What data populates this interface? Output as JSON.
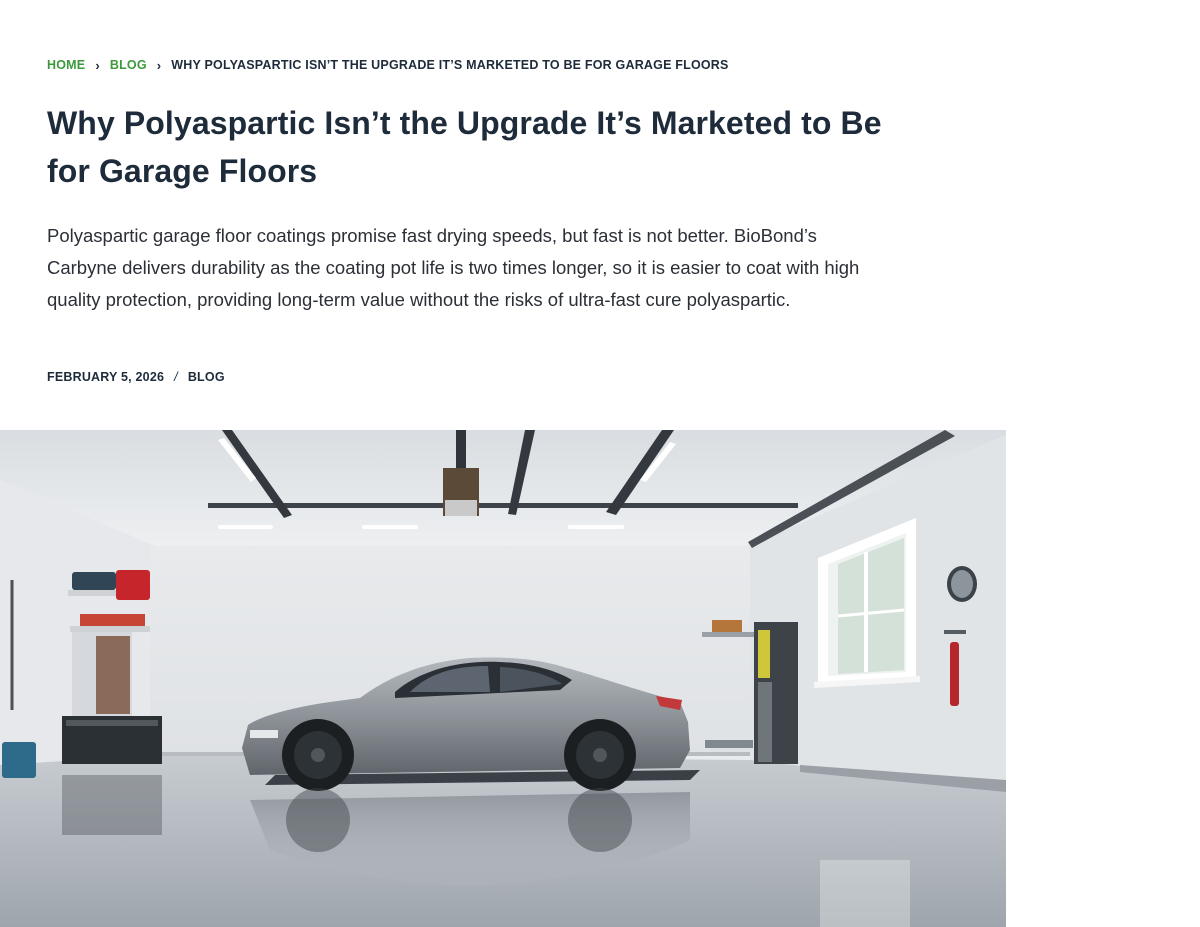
{
  "breadcrumb": {
    "home_label": "HOME",
    "blog_label": "BLOG",
    "current_label": "WHY POLYASPARTIC ISN’T THE UPGRADE IT’S MARKETED TO BE FOR GARAGE FLOORS",
    "separator_icon": "chevron-right-icon",
    "link_color": "#3c9a3c"
  },
  "article": {
    "title": "Why Polyaspartic Isn’t the Upgrade It’s Marketed to Be for Garage Floors",
    "excerpt": "Polyaspartic garage floor coatings promise fast drying speeds, but fast is not better. BioBond’s Carbyne delivers durability as the coating pot life is two times longer, so it is easier to coat with high quality protection, providing long-term value without the risks of ultra-fast cure polyaspartic.",
    "date": "FEBRUARY 5, 2026",
    "meta_separator": "/",
    "category": "BLOG"
  },
  "hero_image": {
    "subject": "garage-with-car-image"
  },
  "colors": {
    "heading": "#1d2b3a",
    "body_text": "#2b2f36",
    "accent": "#3c9a3c"
  }
}
